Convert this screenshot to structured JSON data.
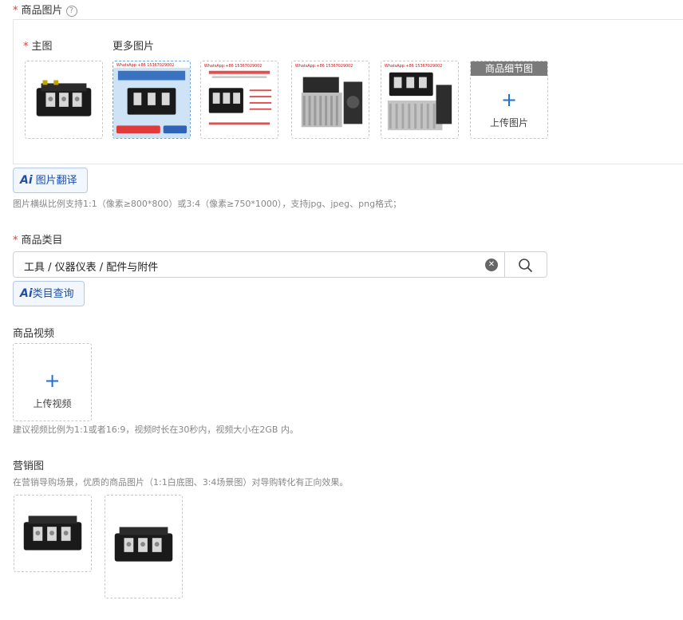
{
  "product_images": {
    "label": "商品图片",
    "help_icon": "question-circle-icon",
    "main_label": "主图",
    "more_label": "更多图片",
    "detail_tag": "商品细节图",
    "upload_label": "上传图片",
    "watermark": "WhatsApp:+86 15367029002"
  },
  "translate_button": {
    "ai": "Ai",
    "label": "图片翻译"
  },
  "image_hint": "图片横纵比例支持1:1（像素≥800*800）或3:4（像素≥750*1000），支持jpg、jpeg、png格式；",
  "category": {
    "label": "商品类目",
    "value": "工具 / 仪器仪表 / 配件与附件",
    "query_ai": "Ai",
    "query_label": "类目查询"
  },
  "video": {
    "label": "商品视频",
    "upload_label": "上传视频",
    "hint": "建议视频比例为1:1或者16:9，视频时长在30秒内，视频大小在2GB 内。"
  },
  "marketing": {
    "label": "营销图",
    "hint": "在营销导购场景，优质的商品图片（1:1白底图、3:4场景图）对导购转化有正向效果。"
  },
  "colors": {
    "required": "#e8383d",
    "accent": "#1f6fd0"
  }
}
